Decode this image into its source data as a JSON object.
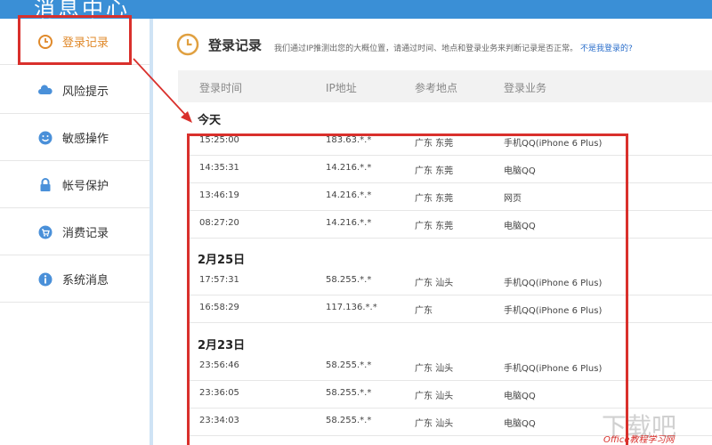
{
  "header": {
    "title": "消息中心"
  },
  "sidebar": {
    "items": [
      {
        "label": "登录记录",
        "icon": "clock-icon",
        "active": true
      },
      {
        "label": "风险提示",
        "icon": "cloud-icon",
        "active": false
      },
      {
        "label": "敏感操作",
        "icon": "smiley-icon",
        "active": false
      },
      {
        "label": "帐号保护",
        "icon": "lock-icon",
        "active": false
      },
      {
        "label": "消费记录",
        "icon": "cart-icon",
        "active": false
      },
      {
        "label": "系统消息",
        "icon": "info-icon",
        "active": false
      }
    ]
  },
  "main": {
    "title": "登录记录",
    "description": "我们通过IP推测出您的大概位置，请通过时间、地点和登录业务来判断记录是否正常。",
    "help_link": "不是我登录的?",
    "columns": [
      "登录时间",
      "IP地址",
      "参考地点",
      "登录业务"
    ],
    "groups": [
      {
        "label": "今天",
        "rows": [
          [
            "15:25:00",
            "183.63.*.*",
            "广东 东莞",
            "手机QQ(iPhone 6 Plus)"
          ],
          [
            "14:35:31",
            "14.216.*.*",
            "广东 东莞",
            "电脑QQ"
          ],
          [
            "13:46:19",
            "14.216.*.*",
            "广东 东莞",
            "网页"
          ],
          [
            "08:27:20",
            "14.216.*.*",
            "广东 东莞",
            "电脑QQ"
          ]
        ]
      },
      {
        "label": "2月25日",
        "rows": [
          [
            "17:57:31",
            "58.255.*.*",
            "广东 汕头",
            "手机QQ(iPhone 6 Plus)"
          ],
          [
            "16:58:29",
            "117.136.*.*",
            "广东",
            "手机QQ(iPhone 6 Plus)"
          ]
        ]
      },
      {
        "label": "2月23日",
        "rows": [
          [
            "23:56:46",
            "58.255.*.*",
            "广东 汕头",
            "手机QQ(iPhone 6 Plus)"
          ],
          [
            "23:36:05",
            "58.255.*.*",
            "广东 汕头",
            "电脑QQ"
          ],
          [
            "23:34:03",
            "58.255.*.*",
            "广东 汕头",
            "电脑QQ"
          ]
        ]
      }
    ]
  },
  "watermark": {
    "big": "下载吧",
    "small": "Office教程学习网"
  },
  "colors": {
    "header": "#3a8fd6",
    "active": "#e0892a",
    "annotation": "#d9302c",
    "link": "#2a6ecb"
  }
}
